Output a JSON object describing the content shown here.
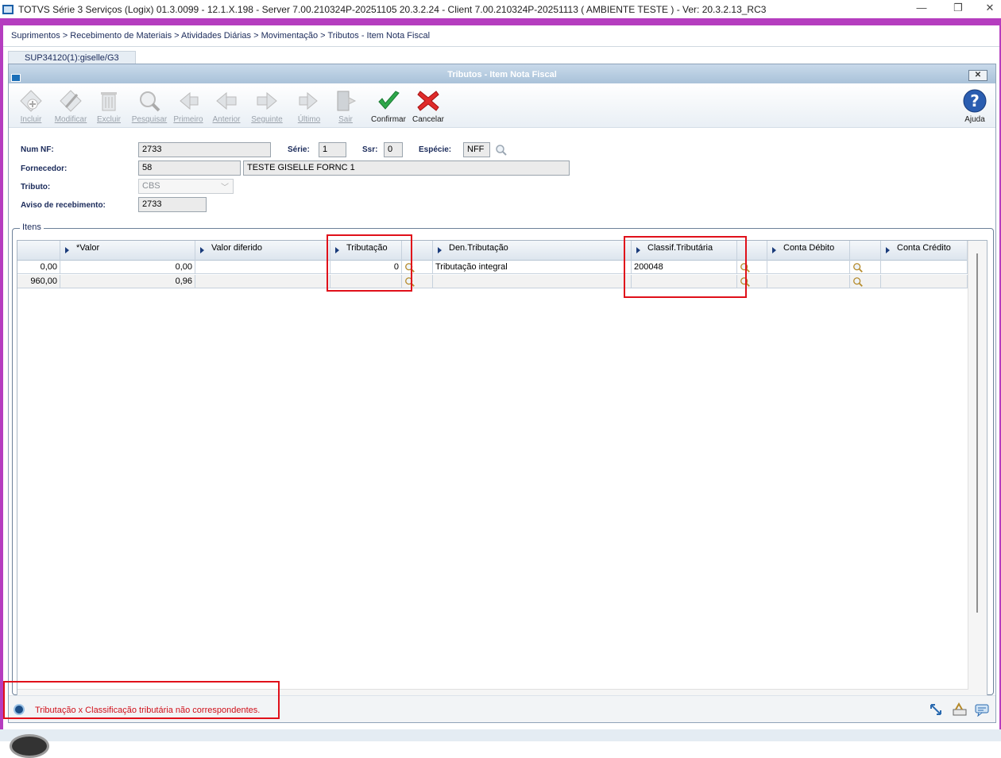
{
  "window": {
    "title": "TOTVS Série 3 Serviços (Logix) 01.3.0099  -  12.1.X.198 - Server 7.00.210324P-20251105 20.3.2.24 - Client 7.00.210324P-20251113     ( AMBIENTE TESTE )  - Ver: 20.3.2.13_RC3",
    "minimize": "—",
    "restore": "❐",
    "close": "✕"
  },
  "breadcrumb": "Suprimentos > Recebimento de Materiais > Atividades Diárias > Movimentação > Tributos - Item Nota Fiscal",
  "session_tab": "SUP34120(1):giselle/G3",
  "dialog": {
    "title": "Tributos - Item Nota Fiscal",
    "close_label": "✕"
  },
  "toolbar": {
    "buttons": [
      {
        "label": "Incluir",
        "icon": "add-icon",
        "enabled": false
      },
      {
        "label": "Modificar",
        "icon": "edit-icon",
        "enabled": false
      },
      {
        "label": "Excluir",
        "icon": "trash-icon",
        "enabled": false
      },
      {
        "label": "Pesquisar",
        "icon": "search-icon",
        "enabled": false
      },
      {
        "label": "Primeiro",
        "icon": "first-icon",
        "enabled": false
      },
      {
        "label": "Anterior",
        "icon": "previous-icon",
        "enabled": false
      },
      {
        "label": "Seguinte",
        "icon": "next-icon",
        "enabled": false
      },
      {
        "label": "Último",
        "icon": "last-icon",
        "enabled": false
      },
      {
        "label": "Sair",
        "icon": "exit-icon",
        "enabled": false
      },
      {
        "label": "Confirmar",
        "icon": "check-icon",
        "enabled": true
      },
      {
        "label": "Cancelar",
        "icon": "cancel-icon",
        "enabled": true
      }
    ],
    "help_label": "Ajuda"
  },
  "form": {
    "num_nf": {
      "label": "Num NF:",
      "value": "2733"
    },
    "serie": {
      "label": "Série:",
      "value": "1"
    },
    "ssr": {
      "label": "Ssr:",
      "value": "0"
    },
    "especie": {
      "label": "Espécie:",
      "value": "NFF"
    },
    "fornecedor": {
      "label": "Fornecedor:",
      "code": "58",
      "name": "TESTE GISELLE FORNC 1"
    },
    "tributo": {
      "label": "Tributo:",
      "value": "CBS"
    },
    "aviso": {
      "label": "Aviso de recebimento:",
      "value": "2733"
    }
  },
  "items": {
    "group_label": "Itens",
    "columns": [
      "",
      "*Valor",
      "Valor diferido",
      "Tributação",
      "",
      "Den.Tributação",
      "Classif.Tributária",
      "",
      "Conta Débito",
      "",
      "Conta Crédito"
    ],
    "rows": [
      [
        "0,00",
        "0,00",
        "",
        "0",
        "",
        "Tributação integral",
        "200048",
        "",
        "",
        "",
        ""
      ],
      [
        "960,00",
        "0,96",
        "",
        "",
        "",
        "",
        "",
        "",
        "",
        "",
        ""
      ]
    ]
  },
  "status": {
    "message": "Tributação x Classificação tributária não correspondentes."
  },
  "colors": {
    "accent": "#b53dbf",
    "highlight": "#e0101a",
    "error_text": "#d0101a"
  }
}
